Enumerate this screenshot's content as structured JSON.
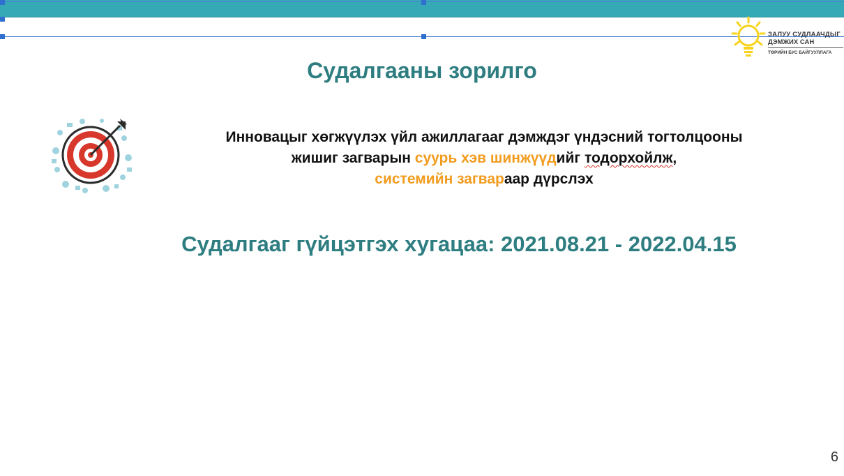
{
  "logo": {
    "line1": "ЗАЛУУ СУДЛААЧДЫГ",
    "line2": "ДЭМЖИХ САН",
    "line3": "ТӨРИЙН БУС БАЙГУУЛЛАГА"
  },
  "slide": {
    "title": "Судалгааны зорилго",
    "goal": {
      "line1": "Инновацыг хөгжүүлэх үйл ажиллагааг дэмждэг үндэсний тогтолцооны",
      "line2_a": "жишиг загварын ",
      "line2_highlight": "суурь хэв шинжүүд",
      "line2_b": "ийг ",
      "line2_c": "тодорхойлж",
      "line2_d": ",",
      "line3_highlight": "системийн загвар",
      "line3_b": "аар дүрслэх"
    },
    "period": "Судалгааг гүйцэтгэх хугацаа: 2021.08.21 - 2022.04.15",
    "page_number": "6"
  },
  "colors": {
    "banner": "#35aab6",
    "title": "#2e7d80",
    "highlight": "#f29c1f",
    "icon_ring": "#d8372b",
    "logo_sun": "#f7d31b"
  },
  "icons": [
    "target-icon",
    "sun-bulb-icon"
  ]
}
